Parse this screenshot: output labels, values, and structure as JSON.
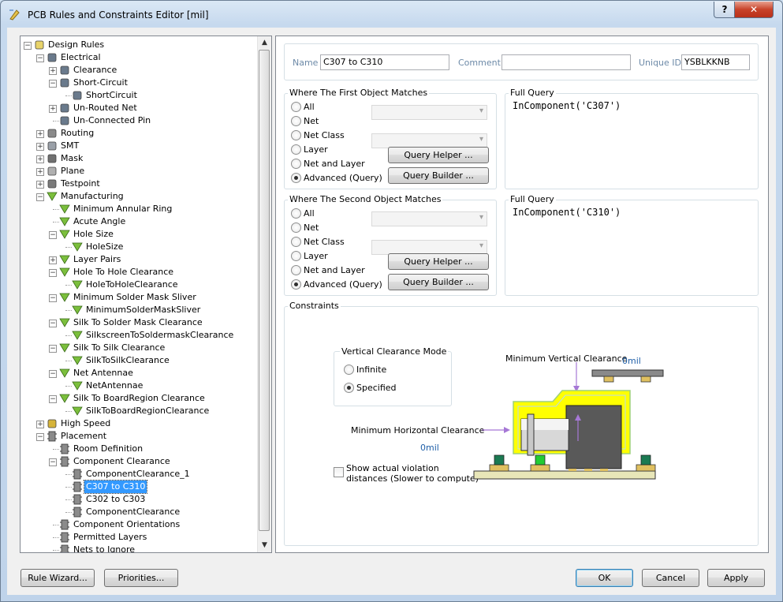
{
  "window": {
    "title": "PCB Rules and Constraints Editor [mil]",
    "help_glyph": "?",
    "close_glyph": "✕"
  },
  "tree": [
    {
      "label": "Design Rules",
      "level": 0,
      "toggle": "-",
      "icon": "rules-folder-icon"
    },
    {
      "label": "Electrical",
      "level": 1,
      "toggle": "-",
      "icon": "electrical-icon"
    },
    {
      "label": "Clearance",
      "level": 2,
      "toggle": "+",
      "icon": "electrical-icon"
    },
    {
      "label": "Short-Circuit",
      "level": 2,
      "toggle": "-",
      "icon": "electrical-icon"
    },
    {
      "label": "ShortCircuit",
      "level": 3,
      "toggle": "",
      "icon": "electrical-icon"
    },
    {
      "label": "Un-Routed Net",
      "level": 2,
      "toggle": "+",
      "icon": "electrical-icon"
    },
    {
      "label": "Un-Connected Pin",
      "level": 2,
      "toggle": "",
      "icon": "electrical-icon"
    },
    {
      "label": "Routing",
      "level": 1,
      "toggle": "+",
      "icon": "routing-icon"
    },
    {
      "label": "SMT",
      "level": 1,
      "toggle": "+",
      "icon": "smt-icon"
    },
    {
      "label": "Mask",
      "level": 1,
      "toggle": "+",
      "icon": "mask-icon"
    },
    {
      "label": "Plane",
      "level": 1,
      "toggle": "+",
      "icon": "plane-icon"
    },
    {
      "label": "Testpoint",
      "level": 1,
      "toggle": "+",
      "icon": "testpoint-icon"
    },
    {
      "label": "Manufacturing",
      "level": 1,
      "toggle": "-",
      "icon": "manufacturing-icon"
    },
    {
      "label": "Minimum Annular Ring",
      "level": 2,
      "toggle": "",
      "icon": "manufacturing-icon"
    },
    {
      "label": "Acute Angle",
      "level": 2,
      "toggle": "",
      "icon": "manufacturing-icon"
    },
    {
      "label": "Hole Size",
      "level": 2,
      "toggle": "-",
      "icon": "manufacturing-icon"
    },
    {
      "label": "HoleSize",
      "level": 3,
      "toggle": "",
      "icon": "manufacturing-icon"
    },
    {
      "label": "Layer Pairs",
      "level": 2,
      "toggle": "+",
      "icon": "manufacturing-icon"
    },
    {
      "label": "Hole To Hole Clearance",
      "level": 2,
      "toggle": "-",
      "icon": "manufacturing-icon"
    },
    {
      "label": "HoleToHoleClearance",
      "level": 3,
      "toggle": "",
      "icon": "manufacturing-icon"
    },
    {
      "label": "Minimum Solder Mask Sliver",
      "level": 2,
      "toggle": "-",
      "icon": "manufacturing-icon"
    },
    {
      "label": "MinimumSolderMaskSliver",
      "level": 3,
      "toggle": "",
      "icon": "manufacturing-icon"
    },
    {
      "label": "Silk To Solder Mask Clearance",
      "level": 2,
      "toggle": "-",
      "icon": "manufacturing-icon"
    },
    {
      "label": "SilkscreenToSoldermaskClearance",
      "level": 3,
      "toggle": "",
      "icon": "manufacturing-icon"
    },
    {
      "label": "Silk To Silk Clearance",
      "level": 2,
      "toggle": "-",
      "icon": "manufacturing-icon"
    },
    {
      "label": "SilkToSilkClearance",
      "level": 3,
      "toggle": "",
      "icon": "manufacturing-icon"
    },
    {
      "label": "Net Antennae",
      "level": 2,
      "toggle": "-",
      "icon": "manufacturing-icon"
    },
    {
      "label": "NetAntennae",
      "level": 3,
      "toggle": "",
      "icon": "manufacturing-icon"
    },
    {
      "label": "Silk To BoardRegion Clearance",
      "level": 2,
      "toggle": "-",
      "icon": "manufacturing-icon"
    },
    {
      "label": "SilkToBoardRegionClearance",
      "level": 3,
      "toggle": "",
      "icon": "manufacturing-icon"
    },
    {
      "label": "High Speed",
      "level": 1,
      "toggle": "+",
      "icon": "high-speed-icon"
    },
    {
      "label": "Placement",
      "level": 1,
      "toggle": "-",
      "icon": "placement-icon"
    },
    {
      "label": "Room Definition",
      "level": 2,
      "toggle": "",
      "icon": "placement-icon"
    },
    {
      "label": "Component Clearance",
      "level": 2,
      "toggle": "-",
      "icon": "placement-icon"
    },
    {
      "label": "ComponentClearance_1",
      "level": 3,
      "toggle": "",
      "icon": "placement-icon"
    },
    {
      "label": "C307 to C310",
      "level": 3,
      "toggle": "",
      "icon": "placement-icon",
      "selected": true
    },
    {
      "label": "C302 to C303",
      "level": 3,
      "toggle": "",
      "icon": "placement-icon"
    },
    {
      "label": "ComponentClearance",
      "level": 3,
      "toggle": "",
      "icon": "placement-icon"
    },
    {
      "label": "Component Orientations",
      "level": 2,
      "toggle": "",
      "icon": "placement-icon"
    },
    {
      "label": "Permitted Layers",
      "level": 2,
      "toggle": "",
      "icon": "placement-icon"
    },
    {
      "label": "Nets to Ignore",
      "level": 2,
      "toggle": "",
      "icon": "placement-icon"
    }
  ],
  "rule": {
    "name_label": "Name",
    "name_value": "C307 to C310",
    "comment_label": "Comment",
    "comment_value": "",
    "uid_label": "Unique ID",
    "uid_value": "YSBLKKNB"
  },
  "first_match": {
    "title": "Where The First Object Matches",
    "options": [
      "All",
      "Net",
      "Net Class",
      "Layer",
      "Net and Layer",
      "Advanced (Query)"
    ],
    "selected": "Advanced (Query)",
    "query_helper": "Query Helper ...",
    "query_builder": "Query Builder ...",
    "full_query_label": "Full Query",
    "full_query": "InComponent('C307')"
  },
  "second_match": {
    "title": "Where The Second Object Matches",
    "options": [
      "All",
      "Net",
      "Net Class",
      "Layer",
      "Net and Layer",
      "Advanced (Query)"
    ],
    "selected": "Advanced (Query)",
    "query_helper": "Query Helper ...",
    "query_builder": "Query Builder ...",
    "full_query_label": "Full Query",
    "full_query": "InComponent('C310')"
  },
  "constraints": {
    "title": "Constraints",
    "mode_title": "Vertical Clearance Mode",
    "mode_infinite": "Infinite",
    "mode_specified": "Specified",
    "mode_selected": "Specified",
    "min_vertical_label": "Minimum Vertical Clearance",
    "min_vertical_value": "0mil",
    "min_horizontal_label": "Minimum Horizontal Clearance",
    "min_horizontal_value": "0mil",
    "show_violation_line1": "Show actual violation",
    "show_violation_line2": "distances (Slower to compute)",
    "show_violation_checked": false
  },
  "buttons": {
    "rule_wizard": "Rule Wizard...",
    "priorities": "Priorities...",
    "ok": "OK",
    "cancel": "Cancel",
    "apply": "Apply"
  },
  "colors": {
    "selection": "#3399ff",
    "value_blue": "#1f5fa8",
    "board_yellow": "#ffff00",
    "component_gray": "#595959"
  }
}
